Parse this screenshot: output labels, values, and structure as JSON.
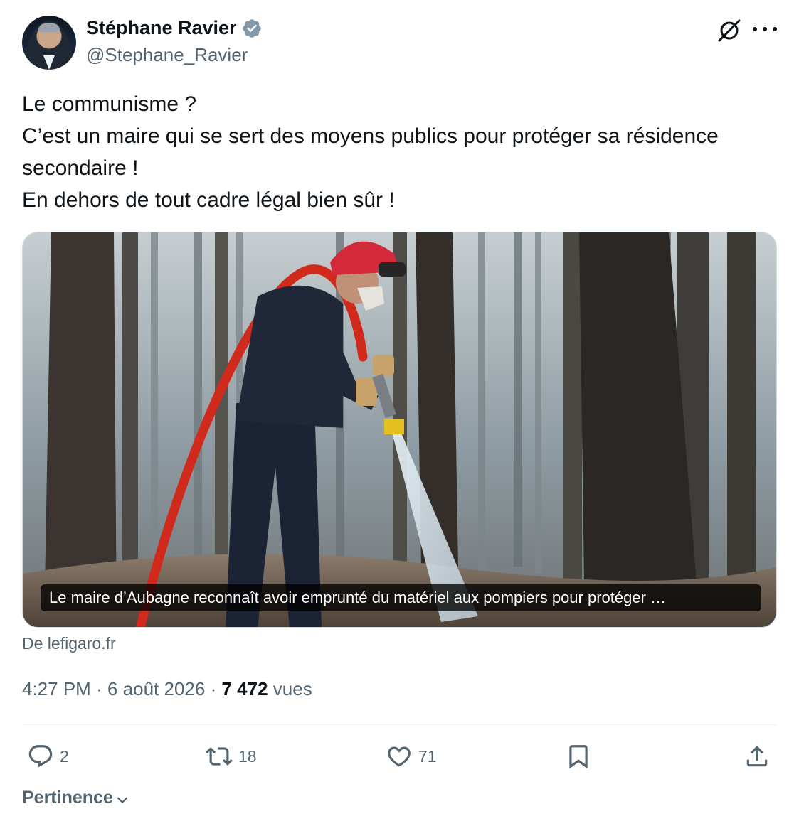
{
  "author": {
    "name": "Stéphane Ravier",
    "handle": "@Stephane_Ravier",
    "verified": true,
    "verified_color": "#829aab"
  },
  "tweet": {
    "lines": [
      "Le communisme ?",
      "C’est un maire qui se sert des moyens publics pour protéger sa résidence",
      "secondaire !",
      "En dehors de tout cadre légal bien sûr !"
    ]
  },
  "link_card": {
    "caption": "Le maire d’Aubagne reconnaît avoir emprunté du matériel aux pompiers pour protéger …",
    "source": "De lefigaro.fr",
    "image_description_icon": "firefighter-photo"
  },
  "meta": {
    "time": "4:27 PM",
    "separator": "·",
    "date": "6 août 2026",
    "views_count": "7 472",
    "views_label": "vues"
  },
  "actions": {
    "reply_count": "2",
    "retweet_count": "18",
    "like_count": "71"
  },
  "sort": {
    "label": "Pertinence"
  },
  "colors": {
    "text_primary": "#0f1419",
    "text_secondary": "#536471",
    "divider": "#eff3f4"
  }
}
